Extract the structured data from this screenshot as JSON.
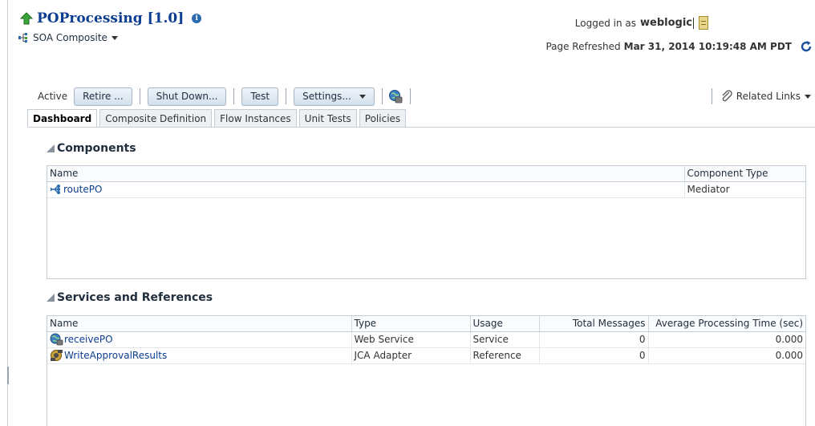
{
  "header": {
    "title": "POProcessing [1.0]",
    "info_symbol": "i",
    "subtitle": "SOA Composite",
    "logged_in_label": "Logged in as",
    "username": "weblogic",
    "refreshed_label": "Page Refreshed",
    "refreshed_timestamp": "Mar 31, 2014 10:19:48 AM PDT"
  },
  "toolbar": {
    "status_label": "Active",
    "retire_label": "Retire ...",
    "shutdown_label": "Shut Down...",
    "test_label": "Test",
    "settings_label": "Settings...",
    "related_links_label": "Related Links"
  },
  "tabs": [
    {
      "label": "Dashboard",
      "active": true
    },
    {
      "label": "Composite Definition",
      "active": false
    },
    {
      "label": "Flow Instances",
      "active": false
    },
    {
      "label": "Unit Tests",
      "active": false
    },
    {
      "label": "Policies",
      "active": false
    }
  ],
  "components": {
    "title": "Components",
    "columns": [
      "Name",
      "Component Type"
    ],
    "rows": [
      {
        "name": "routePO",
        "type": "Mediator",
        "icon": "mediator-icon"
      }
    ]
  },
  "services": {
    "title": "Services and References",
    "columns": [
      "Name",
      "Type",
      "Usage",
      "Total Messages",
      "Average Processing Time (sec)"
    ],
    "rows": [
      {
        "name": "receivePO",
        "type": "Web Service",
        "usage": "Service",
        "total_messages": "0",
        "avg_time": "0.000",
        "icon": "web-service-icon"
      },
      {
        "name": "WriteApprovalResults",
        "type": "JCA Adapter",
        "usage": "Reference",
        "total_messages": "0",
        "avg_time": "0.000",
        "icon": "jca-adapter-icon"
      }
    ]
  },
  "colors": {
    "link": "#0b3d91",
    "accent_green": "#2e9d2e",
    "button_bg": "#dfe9f3"
  }
}
